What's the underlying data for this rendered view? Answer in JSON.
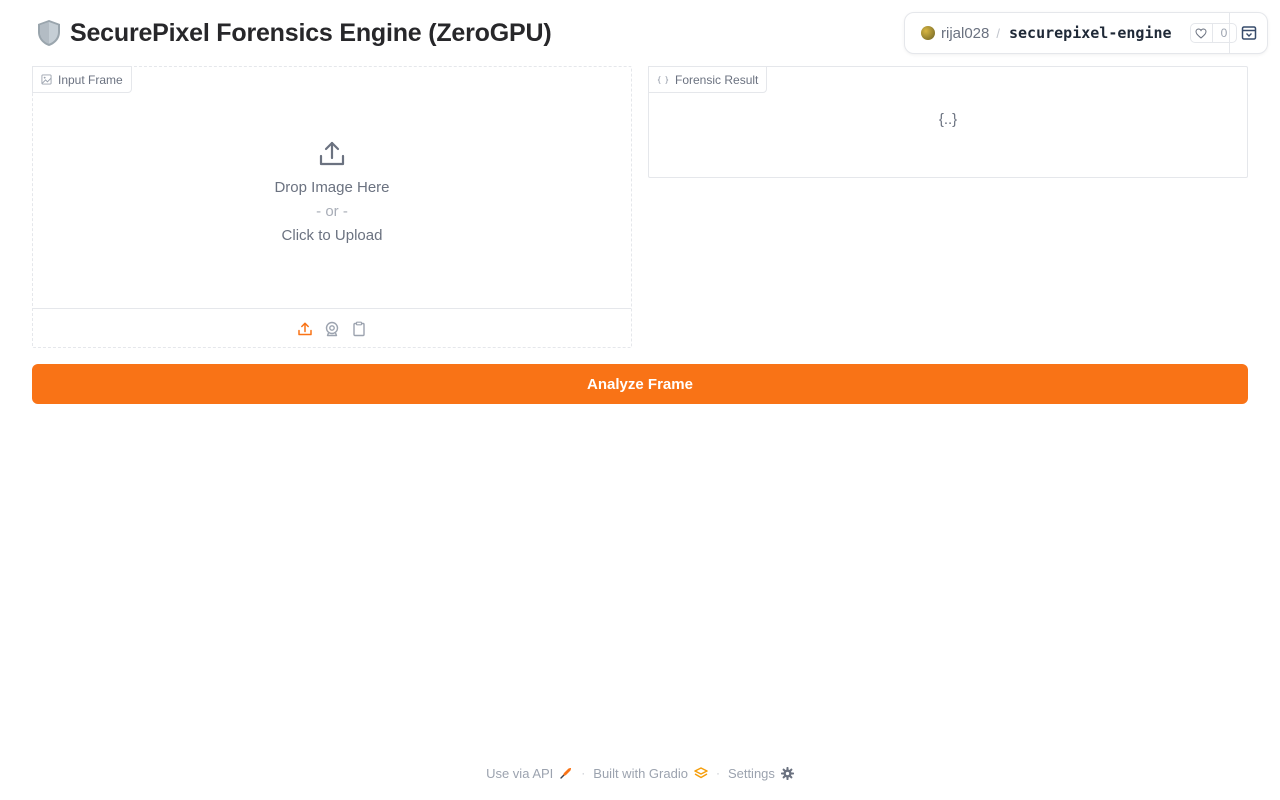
{
  "header": {
    "title": "SecurePixel Forensics Engine (ZeroGPU)",
    "title_icon": "shield-emoji"
  },
  "hf_badge": {
    "owner": "rijal028",
    "separator": "/",
    "repo": "securepixel-engine",
    "likes": "0"
  },
  "input_frame": {
    "label": "Input Frame",
    "drop_text": "Drop Image Here",
    "or_text": "- or -",
    "click_text": "Click to Upload",
    "sources": [
      "upload-icon",
      "webcam-icon",
      "clipboard-icon"
    ],
    "active_source": "upload-icon"
  },
  "forensic_result": {
    "label": "Forensic Result",
    "empty_value": "{..}"
  },
  "analyze_button": {
    "label": "Analyze Frame"
  },
  "footer": {
    "api_label": "Use via API",
    "built_label": "Built with Gradio",
    "settings_label": "Settings",
    "separator": "·"
  },
  "colors": {
    "accent": "#f97316",
    "text_muted": "#6b7280",
    "border": "#e5e7eb"
  }
}
